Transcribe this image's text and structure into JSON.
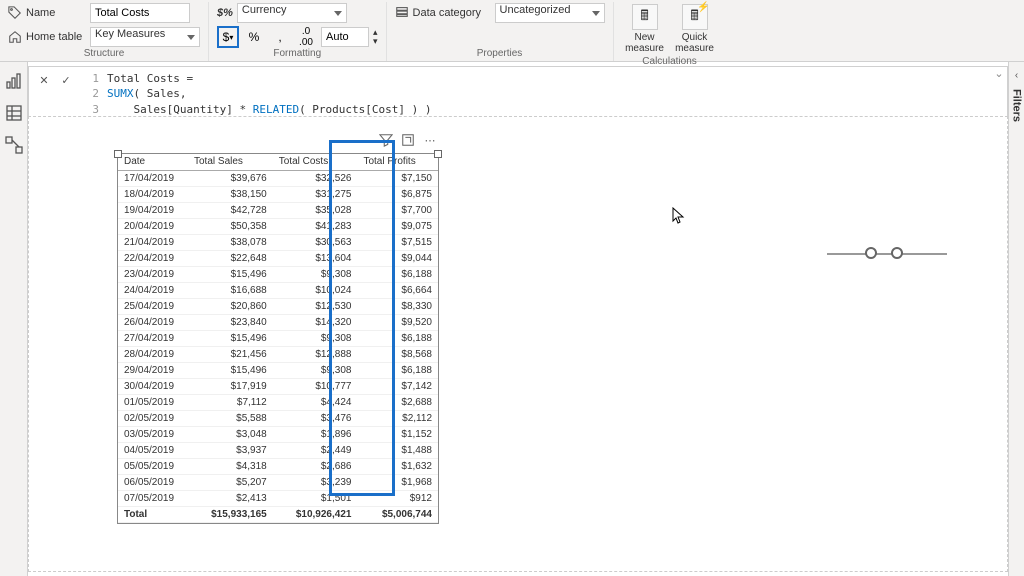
{
  "ribbon": {
    "name_label": "Name",
    "name_value": "Total Costs",
    "home_table_label": "Home table",
    "home_table_value": "Key Measures",
    "structure_label": "Structure",
    "format_select": "Currency",
    "currency_btn": "$",
    "percent_btn": "%",
    "comma_btn": ",",
    "decimal_btn": ".0",
    "auto_value": "Auto",
    "formatting_label": "Formatting",
    "data_category_label": "Data category",
    "data_category_value": "Uncategorized",
    "properties_label": "Properties",
    "new_measure": "New measure",
    "quick_measure": "Quick measure",
    "calculations_label": "Calculations"
  },
  "formula": {
    "line1": "Total Costs =",
    "line2_kw": "SUMX",
    "line2_rest": "( Sales,",
    "line3_pre": "    Sales[Quantity] * ",
    "line3_kw": "RELATED",
    "line3_post": "( Products[Cost] ) )"
  },
  "table": {
    "headers": [
      "Date",
      "Total Sales",
      "Total Costs",
      "Total Profits"
    ],
    "rows": [
      [
        "17/04/2019",
        "$39,676",
        "$32,526",
        "$7,150"
      ],
      [
        "18/04/2019",
        "$38,150",
        "$31,275",
        "$6,875"
      ],
      [
        "19/04/2019",
        "$42,728",
        "$35,028",
        "$7,700"
      ],
      [
        "20/04/2019",
        "$50,358",
        "$41,283",
        "$9,075"
      ],
      [
        "21/04/2019",
        "$38,078",
        "$30,563",
        "$7,515"
      ],
      [
        "22/04/2019",
        "$22,648",
        "$13,604",
        "$9,044"
      ],
      [
        "23/04/2019",
        "$15,496",
        "$9,308",
        "$6,188"
      ],
      [
        "24/04/2019",
        "$16,688",
        "$10,024",
        "$6,664"
      ],
      [
        "25/04/2019",
        "$20,860",
        "$12,530",
        "$8,330"
      ],
      [
        "26/04/2019",
        "$23,840",
        "$14,320",
        "$9,520"
      ],
      [
        "27/04/2019",
        "$15,496",
        "$9,308",
        "$6,188"
      ],
      [
        "28/04/2019",
        "$21,456",
        "$12,888",
        "$8,568"
      ],
      [
        "29/04/2019",
        "$15,496",
        "$9,308",
        "$6,188"
      ],
      [
        "30/04/2019",
        "$17,919",
        "$10,777",
        "$7,142"
      ],
      [
        "01/05/2019",
        "$7,112",
        "$4,424",
        "$2,688"
      ],
      [
        "02/05/2019",
        "$5,588",
        "$3,476",
        "$2,112"
      ],
      [
        "03/05/2019",
        "$3,048",
        "$1,896",
        "$1,152"
      ],
      [
        "04/05/2019",
        "$3,937",
        "$2,449",
        "$1,488"
      ],
      [
        "05/05/2019",
        "$4,318",
        "$2,686",
        "$1,632"
      ],
      [
        "06/05/2019",
        "$5,207",
        "$3,239",
        "$1,968"
      ],
      [
        "07/05/2019",
        "$2,413",
        "$1,501",
        "$912"
      ]
    ],
    "total_label": "Total",
    "totals": [
      "$15,933,165",
      "$10,926,421",
      "$5,006,744"
    ]
  },
  "filters_label": "Filters"
}
